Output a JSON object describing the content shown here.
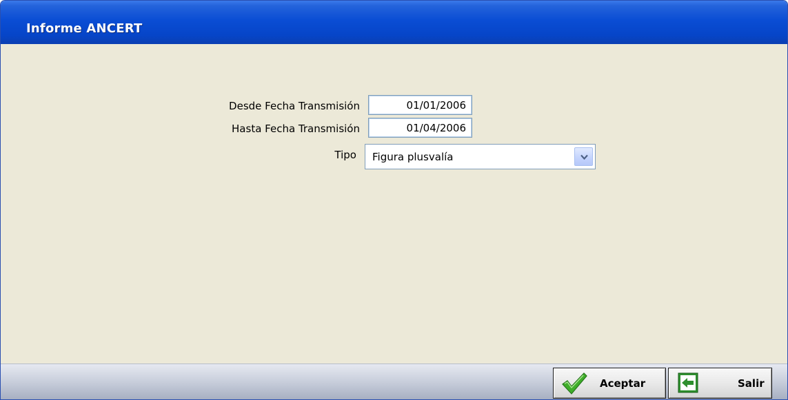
{
  "window": {
    "title": "Informe ANCERT"
  },
  "form": {
    "desde": {
      "label": "Desde Fecha Transmisión",
      "value": "01/01/2006"
    },
    "hasta": {
      "label": "Hasta Fecha Transmisión",
      "value": "01/04/2006"
    },
    "tipo": {
      "label": "Tipo",
      "selected": "Figura plusvalía"
    }
  },
  "buttons": {
    "aceptar": {
      "label": "Aceptar",
      "icon": "check-icon"
    },
    "salir": {
      "label": "Salir",
      "icon": "exit-arrow-icon"
    }
  },
  "colors": {
    "titlebar": "#0a4dd4",
    "background": "#ece9d8",
    "check": "#3fae2a",
    "exit": "#2e8f2e"
  }
}
